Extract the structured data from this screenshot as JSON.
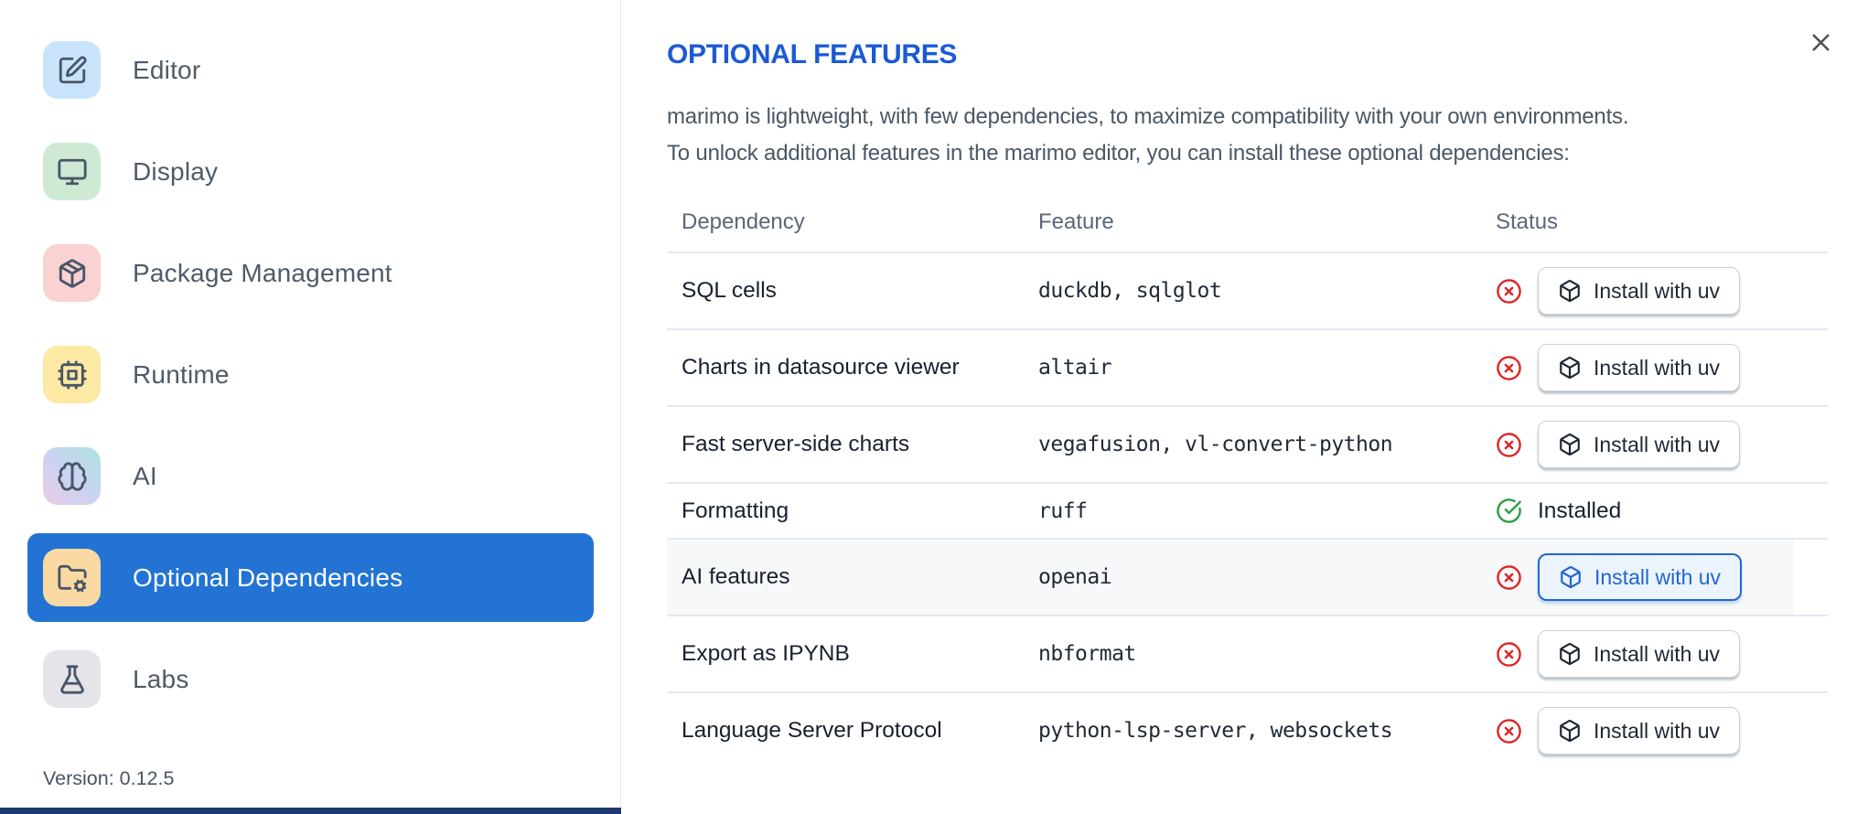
{
  "sidebar": {
    "items": [
      {
        "label": "Editor",
        "icon": "square-pen-icon",
        "tile_color": "#c9e4fa",
        "selected": false
      },
      {
        "label": "Display",
        "icon": "monitor-icon",
        "tile_color": "#cfead4",
        "selected": false
      },
      {
        "label": "Package Management",
        "icon": "package-icon",
        "tile_color": "#fad2d2",
        "selected": false
      },
      {
        "label": "Runtime",
        "icon": "cpu-icon",
        "tile_color": "#fbe9a4",
        "selected": false
      },
      {
        "label": "AI",
        "icon": "brain-icon",
        "tile_color": "gradient(#e9cbe4,#aee3df)",
        "selected": false
      },
      {
        "label": "Optional Dependencies",
        "icon": "folder-cog-icon",
        "tile_color": "#fad9a3",
        "selected": true
      },
      {
        "label": "Labs",
        "icon": "flask-icon",
        "tile_color": "#e4e4e9",
        "selected": false
      }
    ],
    "version": "Version: 0.12.5"
  },
  "panel": {
    "title": "OPTIONAL FEATURES",
    "description_line1": "marimo is lightweight, with few dependencies, to maximize compatibility with your own environments.",
    "description_line2": "To unlock additional features in the marimo editor, you can install these optional dependencies:",
    "close_icon": "x-icon",
    "table": {
      "columns": [
        "Dependency",
        "Feature",
        "Status"
      ],
      "installed_label": "Installed",
      "install_button_label": "Install with uv",
      "rows": [
        {
          "dependency": "SQL cells",
          "feature": "duckdb, sqlglot",
          "status": "not-installed",
          "action_label": "Install with uv",
          "highlighted": false
        },
        {
          "dependency": "Charts in datasource viewer",
          "feature": "altair",
          "status": "not-installed",
          "action_label": "Install with uv",
          "highlighted": false
        },
        {
          "dependency": "Fast server-side charts",
          "feature": "vegafusion, vl-convert-python",
          "status": "not-installed",
          "action_label": "Install with uv",
          "highlighted": false
        },
        {
          "dependency": "Formatting",
          "feature": "ruff",
          "status": "installed",
          "status_label": "Installed",
          "highlighted": false
        },
        {
          "dependency": "AI features",
          "feature": "openai",
          "status": "not-installed",
          "action_label": "Install with uv",
          "highlighted": true
        },
        {
          "dependency": "Export as IPYNB",
          "feature": "nbformat",
          "status": "not-installed",
          "action_label": "Install with uv",
          "highlighted": false
        },
        {
          "dependency": "Language Server Protocol",
          "feature": "python-lsp-server, websockets",
          "status": "not-installed",
          "action_label": "Install with uv",
          "highlighted": false
        }
      ]
    }
  },
  "colors": {
    "accent_blue": "#2273d4",
    "title_blue": "#1c5ad4",
    "status_red": "#dc2626",
    "status_green": "#2e9e44",
    "divider": "#e3e8f1",
    "bottom_strip": "#1e3a6f",
    "highlight_row_bg": "#f7f8f9"
  }
}
